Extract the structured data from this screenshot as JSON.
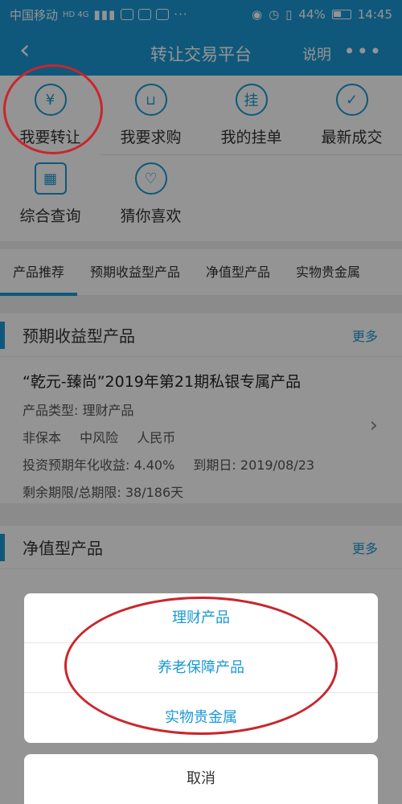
{
  "status_bar": {
    "carrier": "中国移动",
    "badges": "HD 4G",
    "battery": "44%",
    "time": "14:45"
  },
  "navbar": {
    "title": "转让交易平台",
    "explain": "说明",
    "more": "•••"
  },
  "grid": [
    {
      "label": "我要转让",
      "icon": "yen-icon",
      "glyph": "¥"
    },
    {
      "label": "我要求购",
      "icon": "cart-icon",
      "glyph": "🛒"
    },
    {
      "label": "我的挂单",
      "icon": "list-icon",
      "glyph": "挂"
    },
    {
      "label": "最新成交",
      "icon": "check-icon",
      "glyph": "✓"
    },
    {
      "label": "综合查询",
      "icon": "search-grid-icon",
      "glyph": "▦"
    },
    {
      "label": "猜你喜欢",
      "icon": "heart-icon",
      "glyph": "♡"
    }
  ],
  "tabs": [
    "产品推荐",
    "预期收益型产品",
    "净值型产品",
    "实物贵金属"
  ],
  "sections": {
    "expected": {
      "title": "预期收益型产品",
      "more": "更多",
      "product": {
        "name": "“乾元-臻尚”2019年第21期私银专属产品",
        "type": "产品类型: 理财产品",
        "tags": [
          "非保本",
          "中风险",
          "人民币"
        ],
        "yield": "投资预期年化收益: 4.40%",
        "maturity": "到期日: 2019/08/23",
        "term": "剩余期限/总期限: 38/186天"
      }
    },
    "netvalue": {
      "title": "净值型产品",
      "more": "更多"
    }
  },
  "sheet": {
    "items": [
      "理财产品",
      "养老保障产品",
      "实物贵金属"
    ],
    "cancel": "取消"
  },
  "colors": {
    "brand": "#1a98d5",
    "annotation": "#c9262c"
  }
}
